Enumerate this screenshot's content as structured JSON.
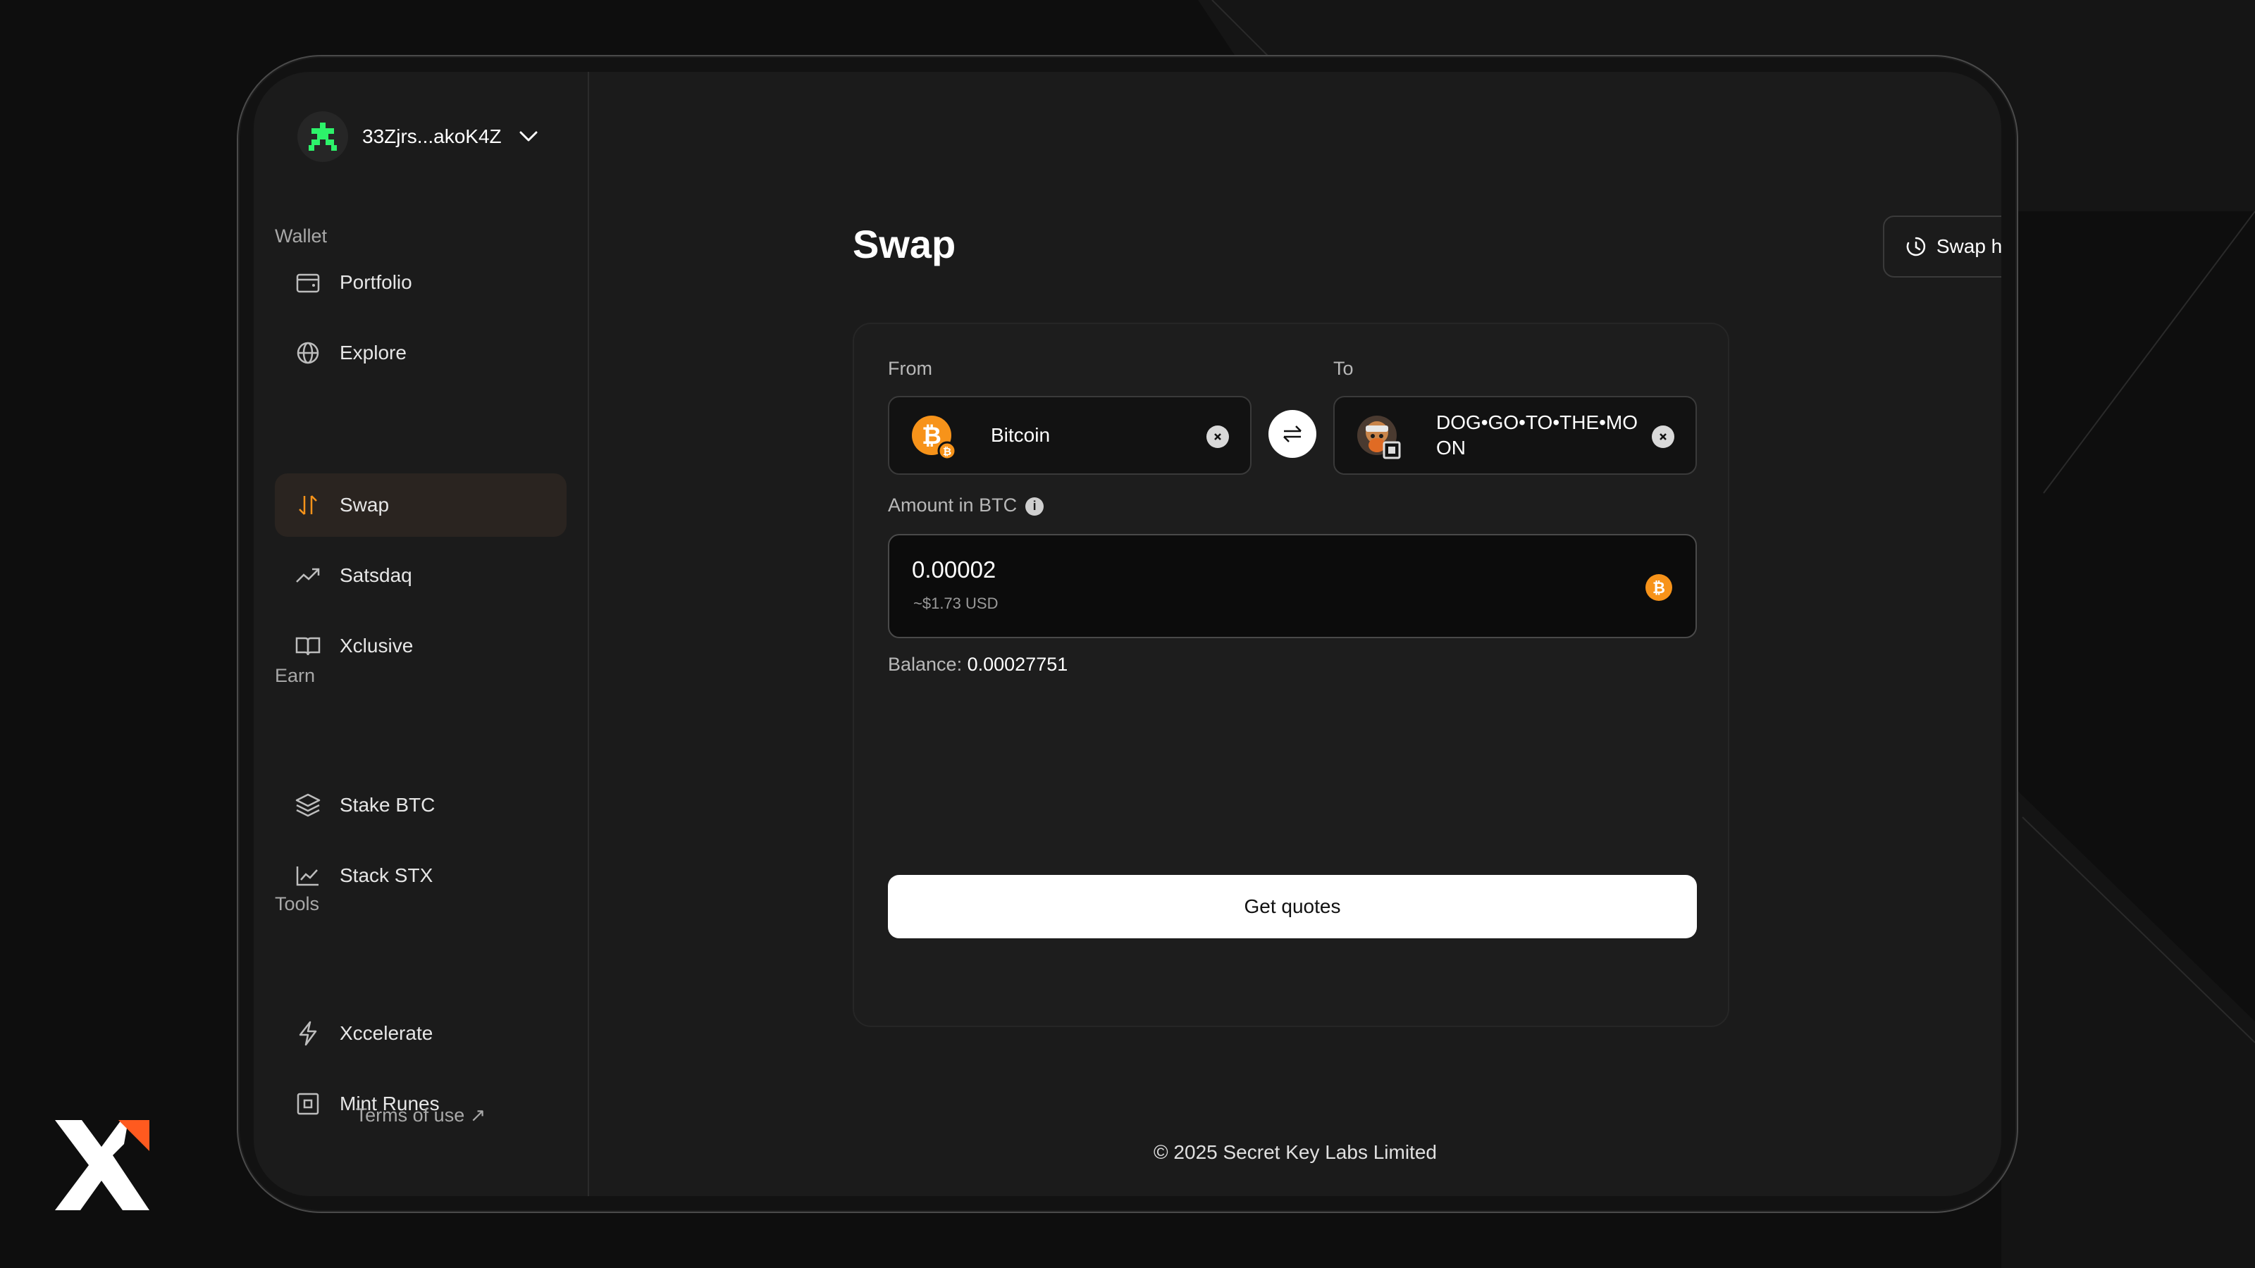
{
  "account": {
    "address": "33Zjrs...akoK4Z"
  },
  "sidebar": {
    "sections": [
      {
        "title": "Wallet",
        "items": [
          {
            "label": "Portfolio",
            "icon": "wallet-icon"
          },
          {
            "label": "Explore",
            "icon": "globe-icon"
          },
          {
            "label": "Swap",
            "icon": "swap-icon",
            "active": true
          },
          {
            "label": "Satsdaq",
            "icon": "trending-up-icon"
          },
          {
            "label": "Xclusive",
            "icon": "book-icon"
          }
        ]
      },
      {
        "title": "Earn",
        "items": [
          {
            "label": "Stake BTC",
            "icon": "layers-icon"
          },
          {
            "label": "Stack STX",
            "icon": "chart-icon"
          }
        ]
      },
      {
        "title": "Tools",
        "items": [
          {
            "label": "Xccelerate",
            "icon": "lightning-icon"
          },
          {
            "label": "Mint Runes",
            "icon": "square-dot-icon"
          }
        ]
      }
    ],
    "terms_label": "Terms of use ↗"
  },
  "main": {
    "title": "Swap",
    "history_label": "Swap history",
    "from_label": "From",
    "to_label": "To",
    "from_token": "Bitcoin",
    "to_token_line1": "DOG•GO•TO•THE•MO",
    "to_token_line2": "ON",
    "amount_label": "Amount in BTC",
    "amount_value": "0.00002",
    "amount_usd": "~$1.73 USD",
    "balance_label": "Balance:",
    "balance_value": "0.00027751",
    "quotes_label": "Get quotes",
    "footer": "© 2025 Secret Key Labs Limited"
  },
  "colors": {
    "accent": "#f7931a",
    "brand_orange": "#ff5a1f",
    "avatar_green": "#2df26a"
  }
}
